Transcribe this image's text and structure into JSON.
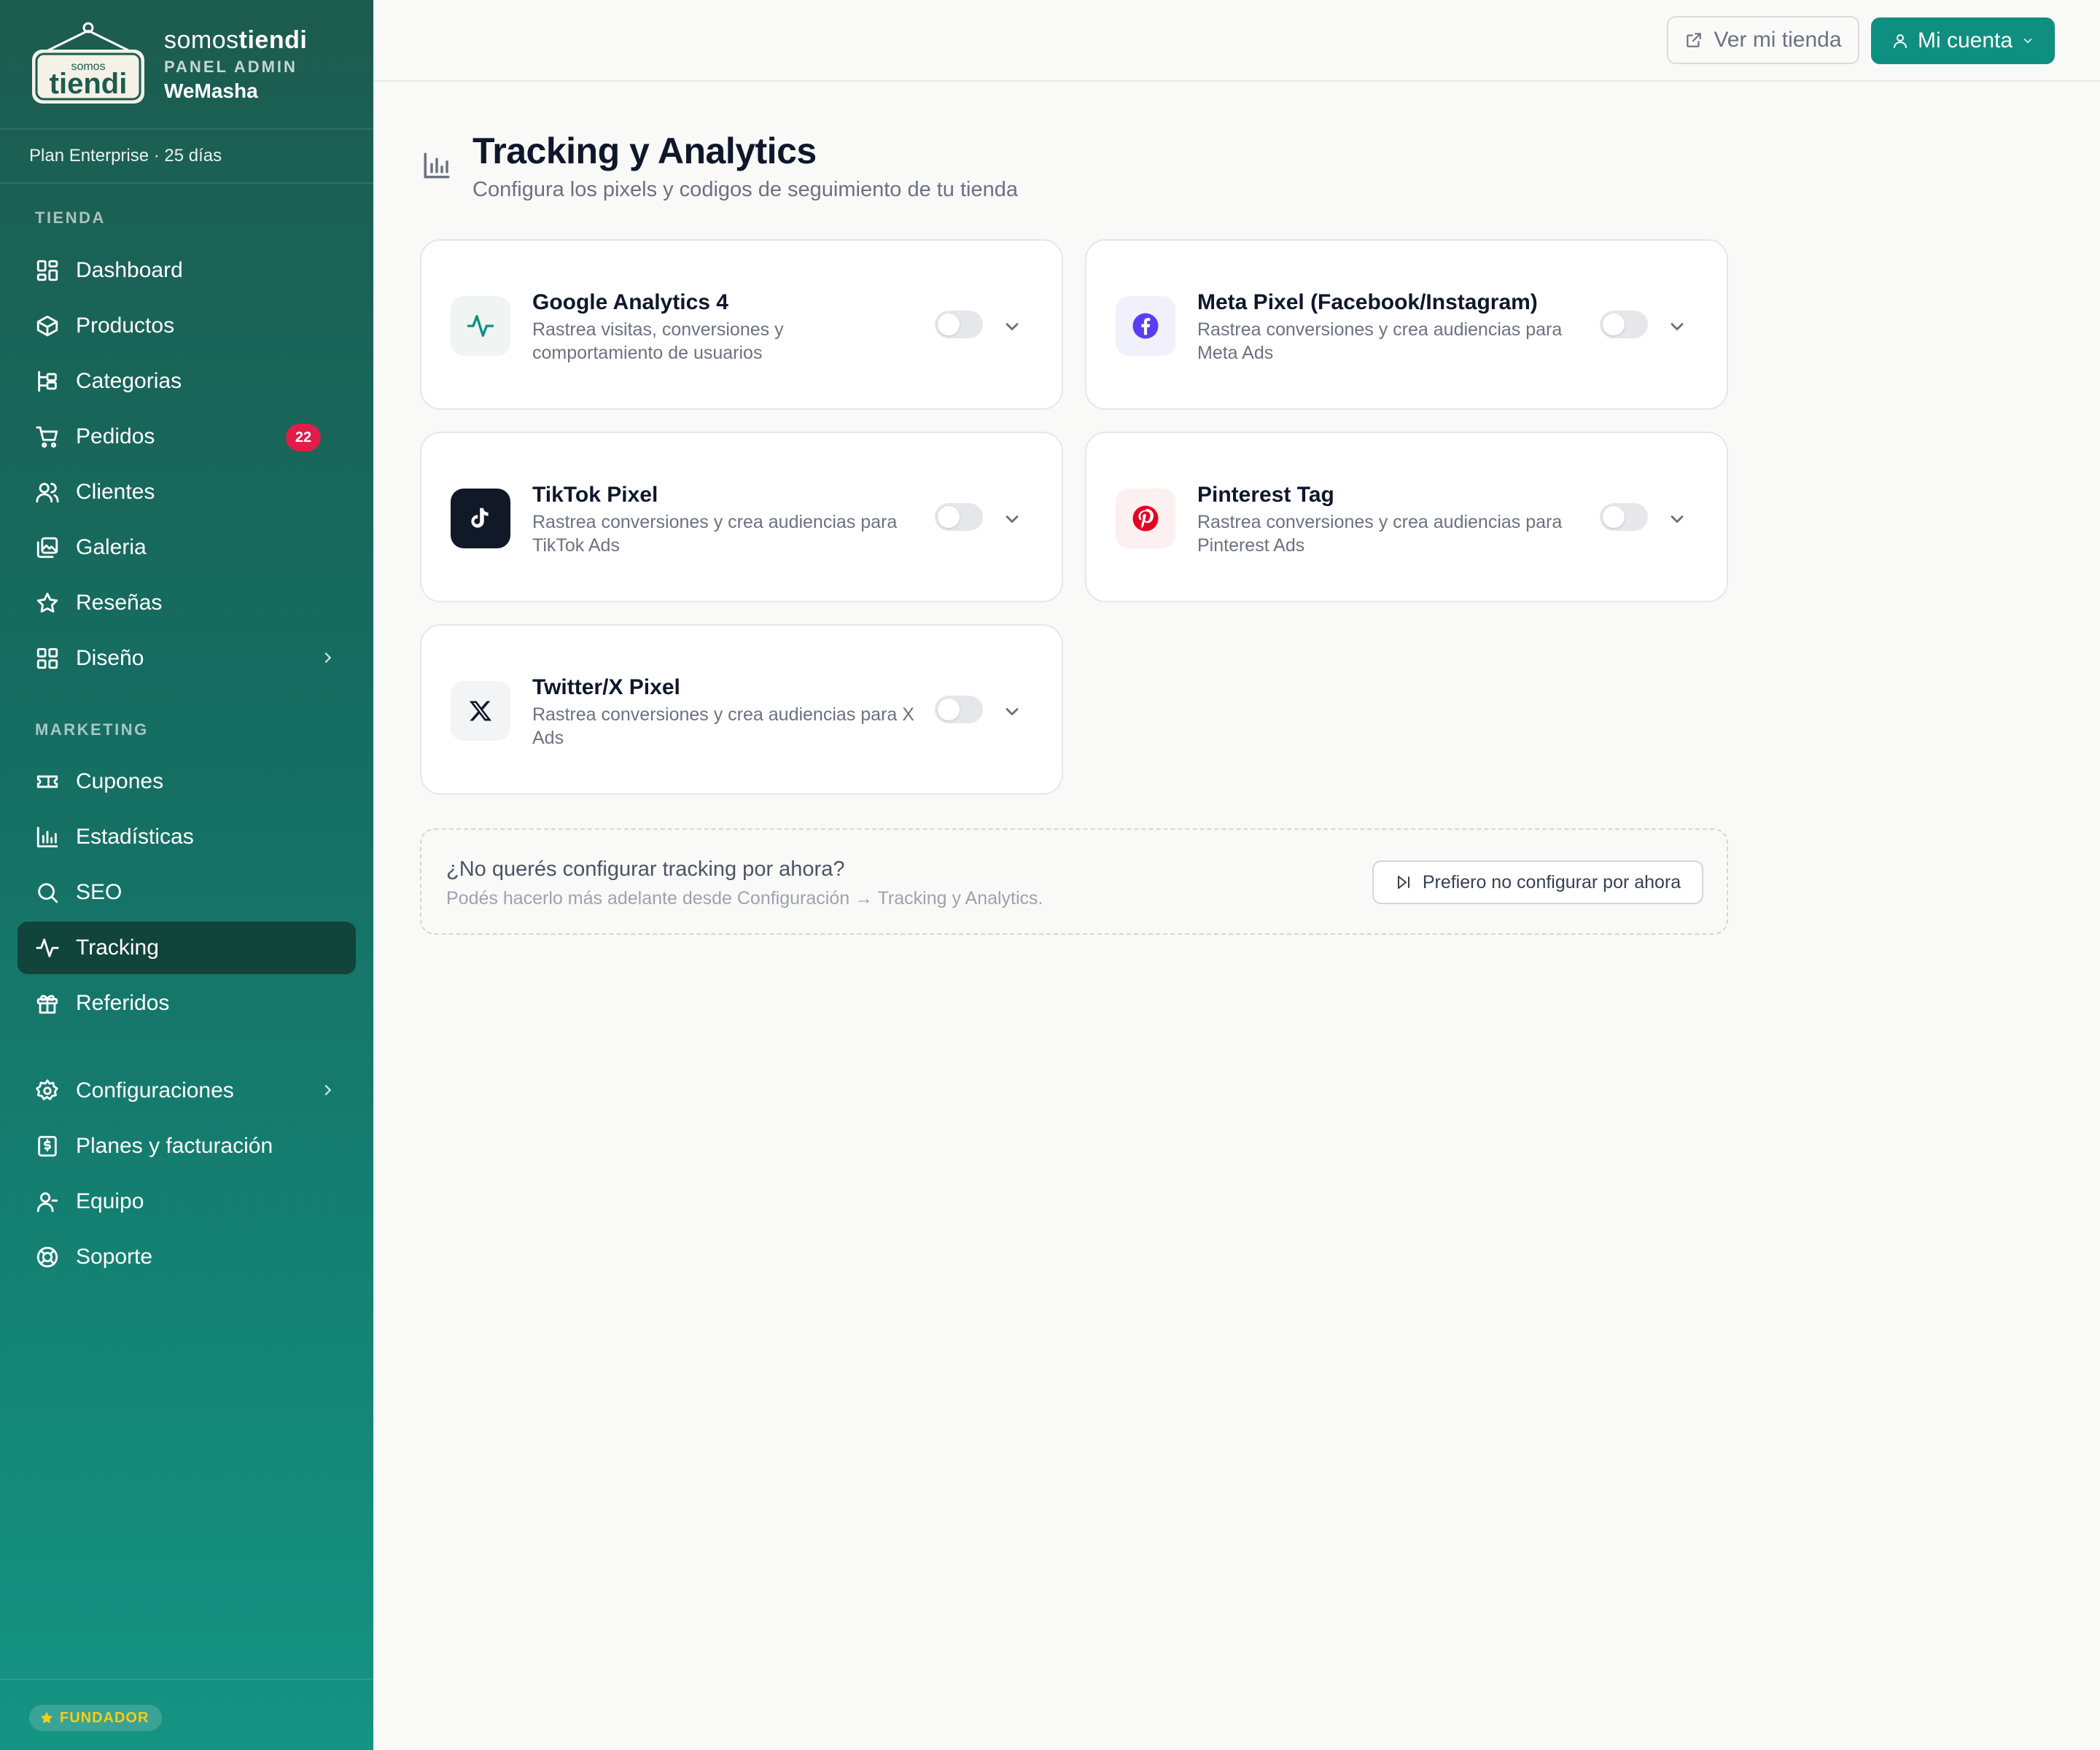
{
  "brand": {
    "logo_small": "somos",
    "logo_big": "tiendi",
    "word_light": "somos",
    "word_bold": "tiendi",
    "panel_label": "PANEL ADMIN",
    "store_name": "WeMasha"
  },
  "plan": {
    "text": "Plan Enterprise · 25 días"
  },
  "sidebar": {
    "sections": {
      "tienda": "TIENDA",
      "marketing": "MARKETING"
    },
    "tienda_items": [
      {
        "label": "Dashboard",
        "icon": "grid-icon"
      },
      {
        "label": "Productos",
        "icon": "box-icon"
      },
      {
        "label": "Categorias",
        "icon": "tree-icon"
      },
      {
        "label": "Pedidos",
        "icon": "cart-icon",
        "badge": "22"
      },
      {
        "label": "Clientes",
        "icon": "users-icon"
      },
      {
        "label": "Galeria",
        "icon": "images-icon"
      },
      {
        "label": "Reseñas",
        "icon": "star-icon"
      },
      {
        "label": "Diseño",
        "icon": "layout-icon"
      }
    ],
    "marketing_items": [
      {
        "label": "Cupones",
        "icon": "ticket-icon"
      },
      {
        "label": "Estadísticas",
        "icon": "bar-chart-icon"
      },
      {
        "label": "SEO",
        "icon": "search-icon"
      },
      {
        "label": "Tracking",
        "icon": "activity-icon",
        "active": true
      },
      {
        "label": "Referidos",
        "icon": "gift-icon"
      }
    ],
    "bottom_items": [
      {
        "label": "Configuraciones",
        "icon": "gear-icon"
      },
      {
        "label": "Planes y facturación",
        "icon": "receipt-icon"
      },
      {
        "label": "Equipo",
        "icon": "user-icon"
      },
      {
        "label": "Soporte",
        "icon": "lifebuoy-icon"
      }
    ],
    "founder_badge": "FUNDADOR"
  },
  "topbar": {
    "store_link": "Ver mi tienda",
    "account": "Mi cuenta"
  },
  "header": {
    "title": "Tracking y Analytics",
    "subtitle": "Configura los pixels y codigos de seguimiento de tu tienda"
  },
  "integrations": [
    {
      "name": "Google Analytics 4",
      "description": "Rastrea visitas, conversiones y comportamiento de usuarios",
      "icon": "activity-icon",
      "enabled": false
    },
    {
      "name": "Meta Pixel (Facebook/Instagram)",
      "description": "Rastrea conversiones y crea audiencias para Meta Ads",
      "icon": "facebook-icon",
      "enabled": false
    },
    {
      "name": "TikTok Pixel",
      "description": "Rastrea conversiones y crea audiencias para TikTok Ads",
      "icon": "tiktok-icon",
      "enabled": false
    },
    {
      "name": "Pinterest Tag",
      "description": "Rastrea conversiones y crea audiencias para Pinterest Ads",
      "icon": "pinterest-icon",
      "enabled": false
    },
    {
      "name": "Twitter/X Pixel",
      "description": "Rastrea conversiones y crea audiencias para X Ads",
      "icon": "x-icon",
      "enabled": false
    }
  ],
  "skip": {
    "title": "¿No querés configurar tracking por ahora?",
    "subtitle": "Podés hacerlo más adelante desde Configuración → Tracking y Analytics.",
    "button": "Prefiero no configurar por ahora"
  },
  "colors": {
    "accent": "#0f8f7f",
    "sidebar_top": "#1c5c4f",
    "sidebar_bottom": "#149483",
    "active_item": "#11443b",
    "badge": "#e11d48",
    "facebook": "#5b3df5",
    "pinterest": "#e60023",
    "ga_icon": "#0f8f7f"
  }
}
